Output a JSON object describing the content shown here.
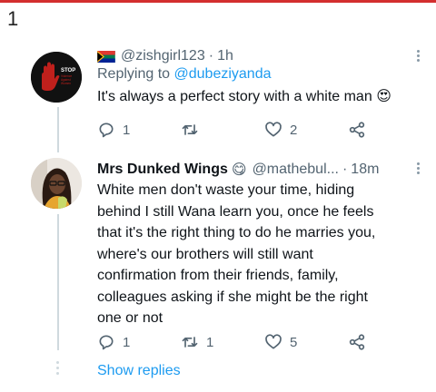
{
  "page": {
    "number": "1"
  },
  "tweet1": {
    "handle": "@zishgirl123",
    "separator": "·",
    "time": "1h",
    "reply_prefix": "Replying to",
    "reply_to": "@dubeziyanda",
    "text": "It's always a perfect story with a white man",
    "emoji": "😍",
    "avatar_text": [
      "STOP",
      "Violence",
      "Against",
      "Women"
    ],
    "reply_count": "1",
    "retweet_count": "",
    "like_count": "2"
  },
  "tweet2": {
    "name": "Mrs Dunked Wings",
    "name_emoji": "😋",
    "handle": "@mathebul...",
    "separator": "·",
    "time": "18m",
    "lines": [
      "White men don't waste your time, hiding",
      "behind I still Wana learn you, once he feels",
      "that it's the right thing to do he marries you,",
      "where's our brothers will still want",
      "confirmation from their friends, family,",
      "colleagues asking if she might be the right",
      "one or not"
    ],
    "reply_count": "1",
    "retweet_count": "1",
    "like_count": "5"
  },
  "footer": {
    "show_replies": "Show replies"
  },
  "colors": {
    "accent": "#1d9bf0",
    "muted": "#536471",
    "top_border": "#d32f2f"
  },
  "icons": [
    "reply-icon",
    "retweet-icon",
    "like-icon",
    "share-icon",
    "more-icon",
    "south-africa-flag-icon"
  ]
}
